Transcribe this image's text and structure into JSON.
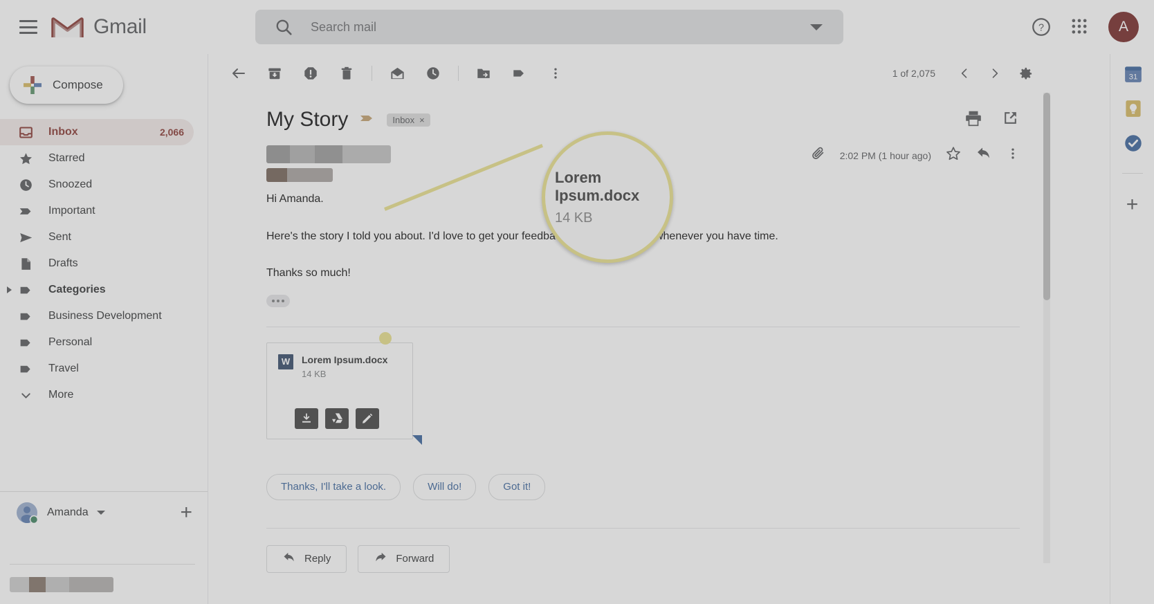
{
  "app": {
    "name": "Gmail",
    "avatar_initial": "A"
  },
  "search": {
    "placeholder": "Search mail",
    "value": ""
  },
  "sidebar": {
    "compose_label": "Compose",
    "items": [
      {
        "label": "Inbox",
        "icon": "inbox-icon",
        "count": "2,066",
        "active": true
      },
      {
        "label": "Starred",
        "icon": "star-icon",
        "count": "",
        "active": false
      },
      {
        "label": "Snoozed",
        "icon": "clock-icon",
        "count": "",
        "active": false
      },
      {
        "label": "Important",
        "icon": "important-marker-icon",
        "count": "",
        "active": false
      },
      {
        "label": "Sent",
        "icon": "send-icon",
        "count": "",
        "active": false
      },
      {
        "label": "Drafts",
        "icon": "draft-icon",
        "count": "",
        "active": false
      },
      {
        "label": "Categories",
        "icon": "label-icon",
        "count": "",
        "active": false
      },
      {
        "label": "Business Development",
        "icon": "label-icon",
        "count": "",
        "active": false
      },
      {
        "label": "Personal",
        "icon": "label-icon",
        "count": "",
        "active": false
      },
      {
        "label": "Travel",
        "icon": "label-icon",
        "count": "",
        "active": false
      },
      {
        "label": "More",
        "icon": "chevron-down-icon",
        "count": "",
        "active": false
      }
    ],
    "user": {
      "name": "Amanda",
      "status": "online"
    }
  },
  "toolbar": {
    "buttons": [
      "back-to-inbox-icon",
      "archive-icon",
      "report-spam-icon",
      "delete-icon",
      "mark-unread-icon",
      "snooze-icon",
      "move-to-icon",
      "labels-icon",
      "more-options-icon"
    ],
    "page_count": "1 of 2,075"
  },
  "email": {
    "subject": "My Story",
    "label": "Inbox",
    "label_remove": "×",
    "timestamp": "2:02 PM (1 hour ago)",
    "body": [
      "Hi Amanda.",
      "Here's the story I told you about. I'd love to get your feedback on it. Just review whenever you have time.",
      "Thanks so much!"
    ],
    "attachment": {
      "filename": "Lorem Ipsum.docx",
      "filesize": "14 KB",
      "file_type_badge": "W",
      "actions": [
        "download-icon",
        "save-to-drive-icon",
        "edit-icon"
      ]
    },
    "smart_replies": [
      "Thanks, I'll take a look.",
      "Will do!",
      "Got it!"
    ],
    "reply_buttons": [
      {
        "label": "Reply",
        "icon": "reply-arrow-icon"
      },
      {
        "label": "Forward",
        "icon": "forward-arrow-icon"
      }
    ]
  },
  "magnifier": {
    "filename": "Lorem Ipsum.docx",
    "filesize": "14 KB",
    "ring_color": "#f7e736"
  },
  "addons": {
    "items": [
      "google-calendar-icon",
      "google-keep-icon",
      "google-tasks-icon"
    ],
    "add_label": "+"
  },
  "colors": {
    "gmail_red": "#d93025",
    "link_blue": "#1a73e8",
    "highlight": "#f7e736",
    "word_blue": "#2b579a"
  }
}
